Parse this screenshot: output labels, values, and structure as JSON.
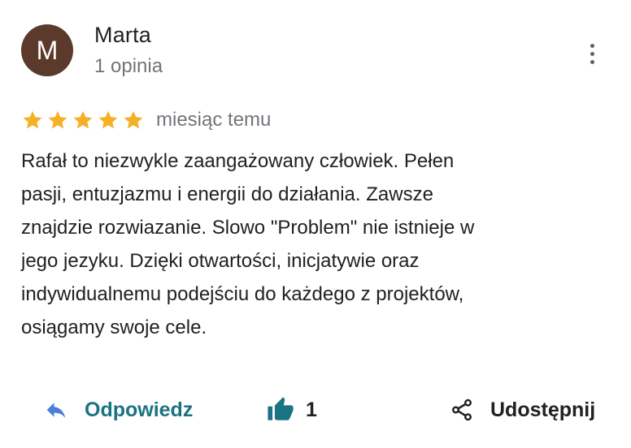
{
  "review": {
    "author": {
      "initial": "M",
      "name": "Marta",
      "reviews_count": "1 opinia",
      "avatar_color": "#5b3a2b"
    },
    "rating": 5,
    "rating_max": 5,
    "star_color": "#f6b026",
    "date": "miesiąc temu",
    "text_lines": [
      "Rafał to niezwykle zaangażowany człowiek. Pełen",
      "pasji, entuzjazmu i energii do działania. Zawsze",
      "znajdzie rozwiazanie. Slowo \"Problem\" nie istnieje w",
      "jego jezyku. Dzięki otwartości, inicjatywie oraz",
      "indywidualnemu podejściu do każdego z projektów,",
      "osiągamy swoje cele."
    ],
    "icons": {
      "more": "more-vertical-icon",
      "reply": "reply-icon",
      "like": "thumb-up-icon",
      "share": "share-icon"
    }
  },
  "actions": {
    "reply_label": "Odpowiedz",
    "like_count": "1",
    "share_label": "Udostępnij",
    "accent_color": "#1a7382",
    "reply_icon_color": "#4a7fd4"
  }
}
